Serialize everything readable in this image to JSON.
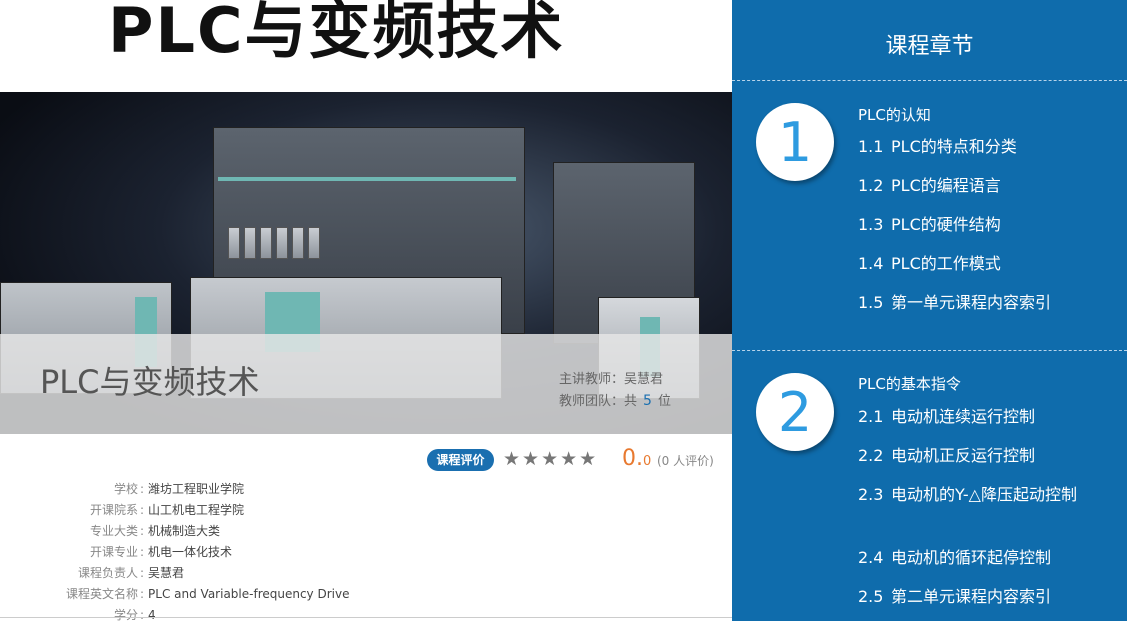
{
  "banner": {
    "title": "PLC与变频技术",
    "course_name": "PLC与变频技术",
    "teacher_label": "主讲教师：",
    "teacher_name": "吴慧君",
    "team_label": "教师团队：共",
    "team_count": "5",
    "team_unit": "位"
  },
  "rating": {
    "badge": "课程评价",
    "stars": "★★★★★",
    "score_int": "0.",
    "score_dec": "0",
    "count": "(0 人评价)"
  },
  "info": [
    {
      "label": "学校",
      "value": "潍坊工程职业学院"
    },
    {
      "label": "开课院系",
      "value": "山工机电工程学院"
    },
    {
      "label": "专业大类",
      "value": "机械制造大类"
    },
    {
      "label": "开课专业",
      "value": "机电一体化技术"
    },
    {
      "label": "课程负责人",
      "value": "吴慧君"
    },
    {
      "label": "课程英文名称",
      "value": "PLC and Variable-frequency Drive"
    },
    {
      "label": "学分",
      "value": "4"
    }
  ],
  "panel": {
    "title": "课程章节",
    "chapters": [
      {
        "number": "1",
        "title": "PLC的认知",
        "items": [
          {
            "no": "1.1",
            "text": "PLC的特点和分类"
          },
          {
            "no": "1.2",
            "text": "PLC的编程语言"
          },
          {
            "no": "1.3",
            "text": "PLC的硬件结构"
          },
          {
            "no": "1.4",
            "text": "PLC的工作模式"
          },
          {
            "no": "1.5",
            "text": "第一单元课程内容索引"
          }
        ]
      },
      {
        "number": "2",
        "title": "PLC的基本指令",
        "items": [
          {
            "no": "2.1",
            "text": "电动机连续运行控制"
          },
          {
            "no": "2.2",
            "text": "电动机正反运行控制"
          },
          {
            "no": "2.3",
            "text": "电动机的Y-△降压起动控制"
          },
          {
            "no": "2.4",
            "text": "电动机的循环起停控制"
          },
          {
            "no": "2.5",
            "text": "第二单元课程内容索引"
          }
        ]
      }
    ]
  },
  "colors": {
    "panel": "#0f6cac",
    "accent": "#1a6fb0",
    "score": "#e8792f"
  }
}
